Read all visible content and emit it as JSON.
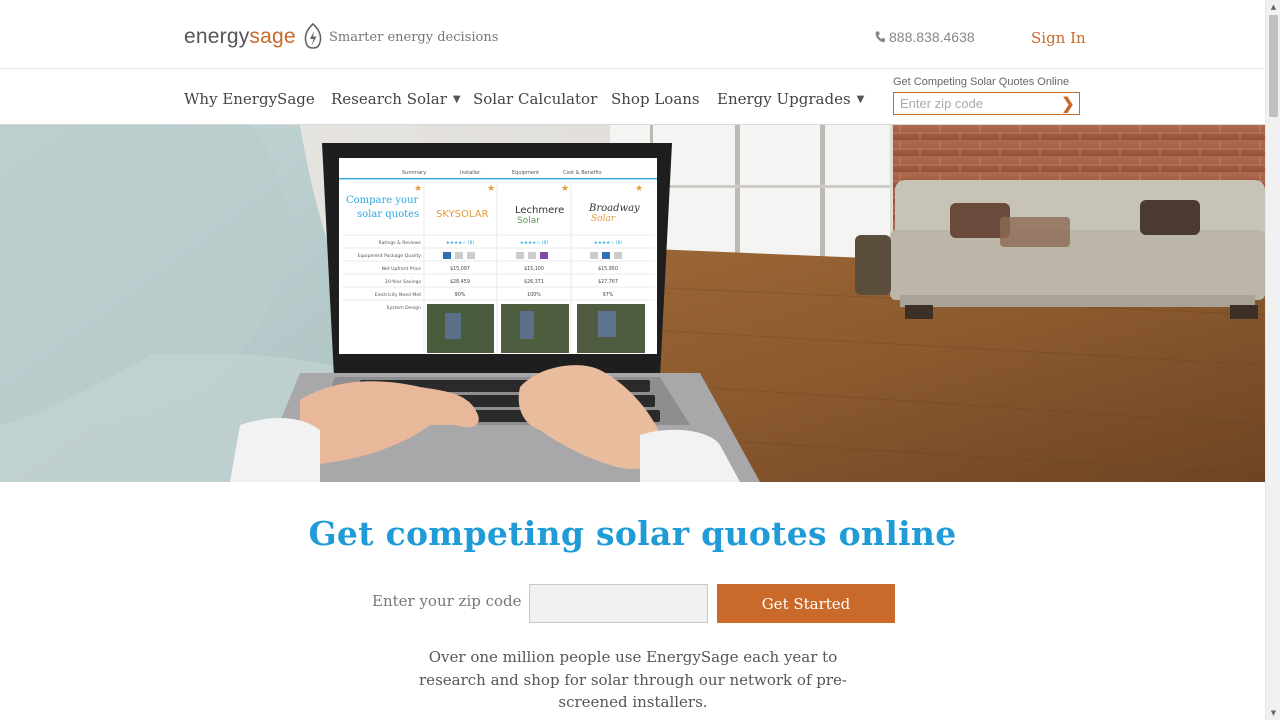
{
  "header": {
    "logo_part1": "energy",
    "logo_part2": "sage",
    "logo_icon": "leaf-bolt-icon",
    "tagline": "Smarter energy decisions",
    "phone_icon": "phone-icon",
    "phone": "888.838.4638",
    "sign_in": "Sign In"
  },
  "nav": {
    "items": [
      {
        "label": "Why EnergySage",
        "dropdown": false
      },
      {
        "label": "Research Solar",
        "dropdown": true
      },
      {
        "label": "Solar Calculator",
        "dropdown": false
      },
      {
        "label": "Shop Loans",
        "dropdown": false
      },
      {
        "label": "Energy Upgrades",
        "dropdown": true
      }
    ],
    "quote_label": "Get Competing Solar Quotes Online",
    "zip_placeholder": "Enter zip code",
    "zip_go_icon": "chevron-right-icon",
    "caret": "▼"
  },
  "hero": {
    "screen": {
      "tabs": [
        "Summary",
        "Installer",
        "Equipment",
        "Cost & Benefits"
      ],
      "title_line1": "Compare your",
      "title_line2": "solar quotes",
      "installers": [
        {
          "line1": "SKYSOLAR",
          "line2": ""
        },
        {
          "line1": "Lechmere",
          "line2": "Solar"
        },
        {
          "line1": "Broadway",
          "line2": "Solar"
        }
      ],
      "row_labels": [
        "Ratings & Reviews",
        "Equipment Package Quality",
        "Net Upfront Price",
        "20-Year Savings",
        "Electricity Need Met",
        "System Design"
      ],
      "ratings": [
        "★★★★☆ (8)",
        "★★★★☆ (8)",
        "★★★★☆ (8)"
      ],
      "prices": [
        "$15,097",
        "$15,100",
        "$15,950"
      ],
      "savings": [
        "$28,459",
        "$26,371",
        "$27,767"
      ],
      "need_met": [
        "90%",
        "100%",
        "97%"
      ]
    }
  },
  "cta": {
    "headline": "Get competing solar quotes online",
    "zip_label": "Enter your zip code",
    "button": "Get Started",
    "blurb": "Over one million people use EnergySage each year to research and shop for solar through our network of pre-screened installers."
  },
  "colors": {
    "brand_orange": "#c9692a",
    "headline_blue": "#1f9bd7"
  }
}
